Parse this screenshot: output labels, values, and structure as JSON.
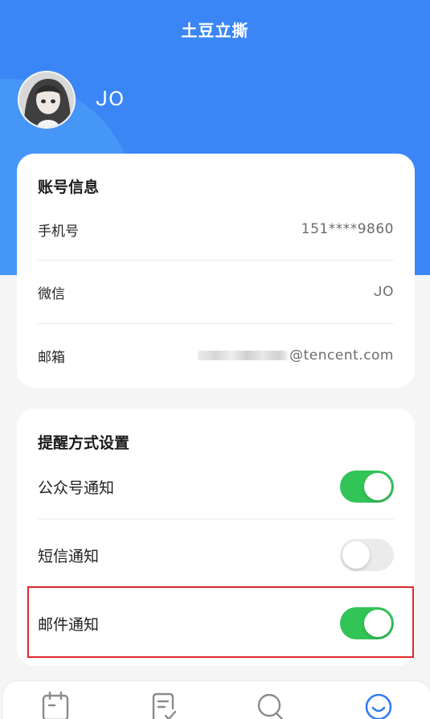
{
  "header": {
    "title": "土豆立撕",
    "username": "ᒍO"
  },
  "account": {
    "heading": "账号信息",
    "rows": [
      {
        "label": "手机号",
        "value": "151****9860"
      },
      {
        "label": "微信",
        "value": "ᒍO"
      },
      {
        "label": "邮箱",
        "value": "@tencent.com"
      }
    ]
  },
  "reminder": {
    "heading": "提醒方式设置",
    "rows": [
      {
        "label": "公众号通知",
        "enabled": true
      },
      {
        "label": "短信通知",
        "enabled": false
      },
      {
        "label": "邮件通知",
        "enabled": true
      }
    ]
  },
  "tabbar": {
    "items": [
      {
        "icon": "calendar-icon",
        "active": false
      },
      {
        "icon": "checklist-icon",
        "active": false
      },
      {
        "icon": "search-icon",
        "active": false
      },
      {
        "icon": "profile-smile-icon",
        "active": true
      }
    ]
  },
  "colors": {
    "header_blue": "#3b86f6",
    "toggle_on": "#33c457",
    "toggle_off": "#ebebeb",
    "highlight": "#e0262b",
    "tab_active": "#2f7cf6",
    "tab_inactive": "#8a8a8a"
  }
}
